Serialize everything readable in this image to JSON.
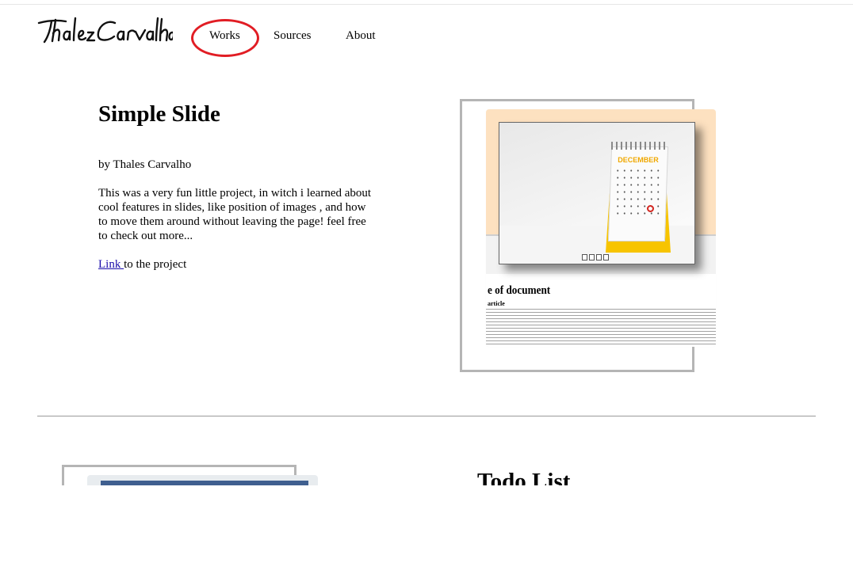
{
  "brand": {
    "logo_text": "Thalez Carvalho"
  },
  "nav": {
    "items": [
      {
        "label": "Works"
      },
      {
        "label": "Sources"
      },
      {
        "label": "About"
      }
    ],
    "highlight_color": "#e11d24"
  },
  "projects": [
    {
      "title": "Simple Slide",
      "author": "by Thales Carvalho",
      "description": "This was a very fun little project, in witch i learned about cool features in slides, like position of images , and how to move them around without leaving the page! feel free to check out more...",
      "link_label": "Link ",
      "link_suffix": "to the project",
      "preview": {
        "calendar_month": "DECEMBER",
        "doc_title": "e of document",
        "doc_subtitle": "article"
      }
    },
    {
      "title": "Todo List"
    }
  ],
  "colors": {
    "link": "#1a0dab",
    "frame": "#b5b5b5",
    "preview_band": "#fde1c0"
  }
}
